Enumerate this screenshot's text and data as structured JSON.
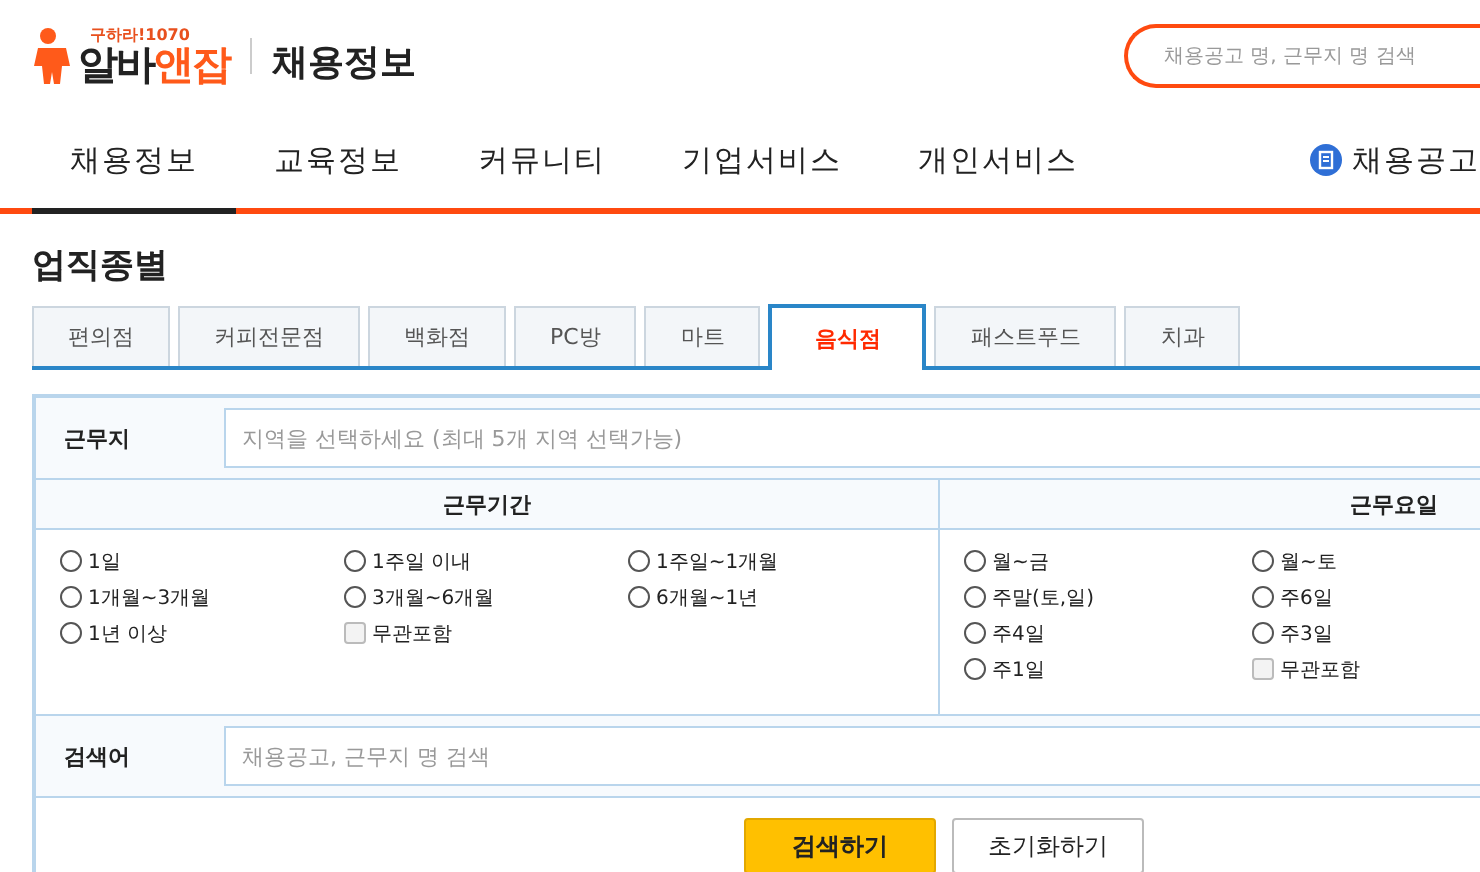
{
  "header": {
    "logo": {
      "tagline": "구하라!1070",
      "name_main": "알바",
      "name_accent": "앤잡"
    },
    "section_title": "채용정보",
    "search": {
      "placeholder": "채용공고 명, 근무지 명 검색"
    }
  },
  "nav": {
    "items": [
      {
        "label": "채용정보",
        "selected": true
      },
      {
        "label": "교육정보",
        "selected": false
      },
      {
        "label": "커뮤니티",
        "selected": false
      },
      {
        "label": "기업서비스",
        "selected": false
      },
      {
        "label": "개인서비스",
        "selected": false
      }
    ],
    "right_link": "채용공고"
  },
  "page_title": "업직종별",
  "tabs": [
    {
      "label": "편의점",
      "selected": false
    },
    {
      "label": "커피전문점",
      "selected": false
    },
    {
      "label": "백화점",
      "selected": false
    },
    {
      "label": "PC방",
      "selected": false
    },
    {
      "label": "마트",
      "selected": false
    },
    {
      "label": "음식점",
      "selected": true
    },
    {
      "label": "패스트푸드",
      "selected": false
    },
    {
      "label": "치과",
      "selected": false
    }
  ],
  "filters": {
    "location": {
      "label": "근무지",
      "placeholder": "지역을 선택하세요 (최대 5개 지역 선택가능)"
    },
    "groups": [
      {
        "title": "근무기간",
        "options": [
          {
            "kind": "radio",
            "label": "1일",
            "checked": false
          },
          {
            "kind": "radio",
            "label": "1주일 이내",
            "checked": false
          },
          {
            "kind": "radio",
            "label": "1주일~1개월",
            "checked": false
          },
          {
            "kind": "radio",
            "label": "1개월~3개월",
            "checked": false
          },
          {
            "kind": "radio",
            "label": "3개월~6개월",
            "checked": false
          },
          {
            "kind": "radio",
            "label": "6개월~1년",
            "checked": false
          },
          {
            "kind": "radio",
            "label": "1년 이상",
            "checked": false
          },
          {
            "kind": "checkbox",
            "label": "무관포함",
            "checked": false
          }
        ]
      },
      {
        "title": "근무요일",
        "options": [
          {
            "kind": "radio",
            "label": "월~금",
            "checked": false
          },
          {
            "kind": "radio",
            "label": "월~토",
            "checked": false
          },
          {
            "kind": "radio",
            "label": "주말(토,일)",
            "checked": false
          },
          {
            "kind": "radio",
            "label": "주6일",
            "checked": false
          },
          {
            "kind": "radio",
            "label": "주4일",
            "checked": false
          },
          {
            "kind": "radio",
            "label": "주3일",
            "checked": false
          },
          {
            "kind": "radio",
            "label": "주1일",
            "checked": false
          },
          {
            "kind": "checkbox",
            "label": "무관포함",
            "checked": false
          }
        ]
      }
    ],
    "keyword": {
      "label": "검색어",
      "placeholder": "채용공고, 근무지 명 검색"
    }
  },
  "buttons": [
    {
      "kind": "primary",
      "label": "검색하기"
    },
    {
      "kind": "secondary",
      "label": "초기화하기"
    }
  ]
}
